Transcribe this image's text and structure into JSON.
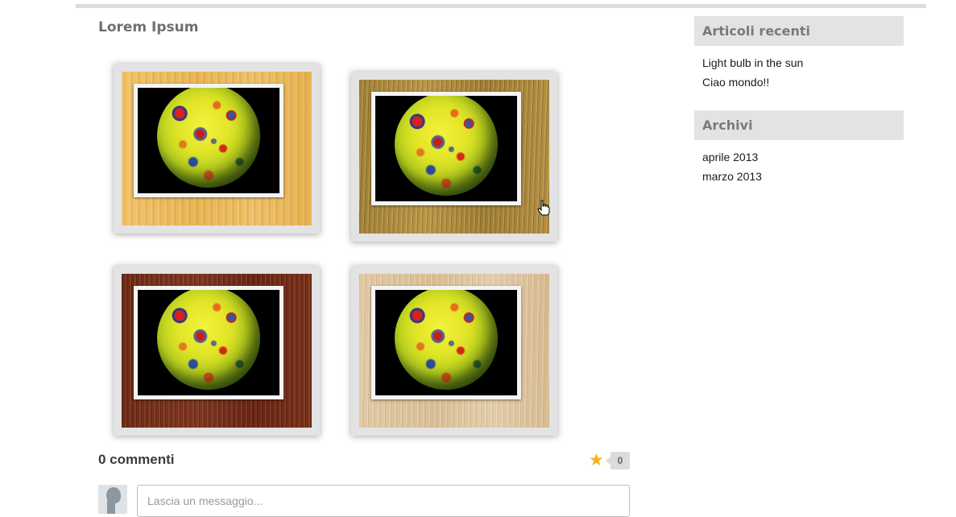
{
  "post": {
    "title": "Lorem Ipsum",
    "gallery": [
      {
        "frame": "maple"
      },
      {
        "frame": "oak"
      },
      {
        "frame": "cherry"
      },
      {
        "frame": "ash"
      }
    ]
  },
  "comments": {
    "title": "0 commenti",
    "count": "0",
    "input_placeholder": "Lascia un messaggio..."
  },
  "sidebar": {
    "recent": {
      "title": "Articoli recenti",
      "links": [
        "Light bulb in the sun",
        "Ciao mondo!!"
      ]
    },
    "archives": {
      "title": "Archivi",
      "links": [
        "aprile 2013",
        "marzo 2013"
      ]
    }
  },
  "colors": {
    "star": "#f3b31b",
    "widget_header_bg": "#e3e3e2",
    "rule": "#dcdcdc"
  }
}
